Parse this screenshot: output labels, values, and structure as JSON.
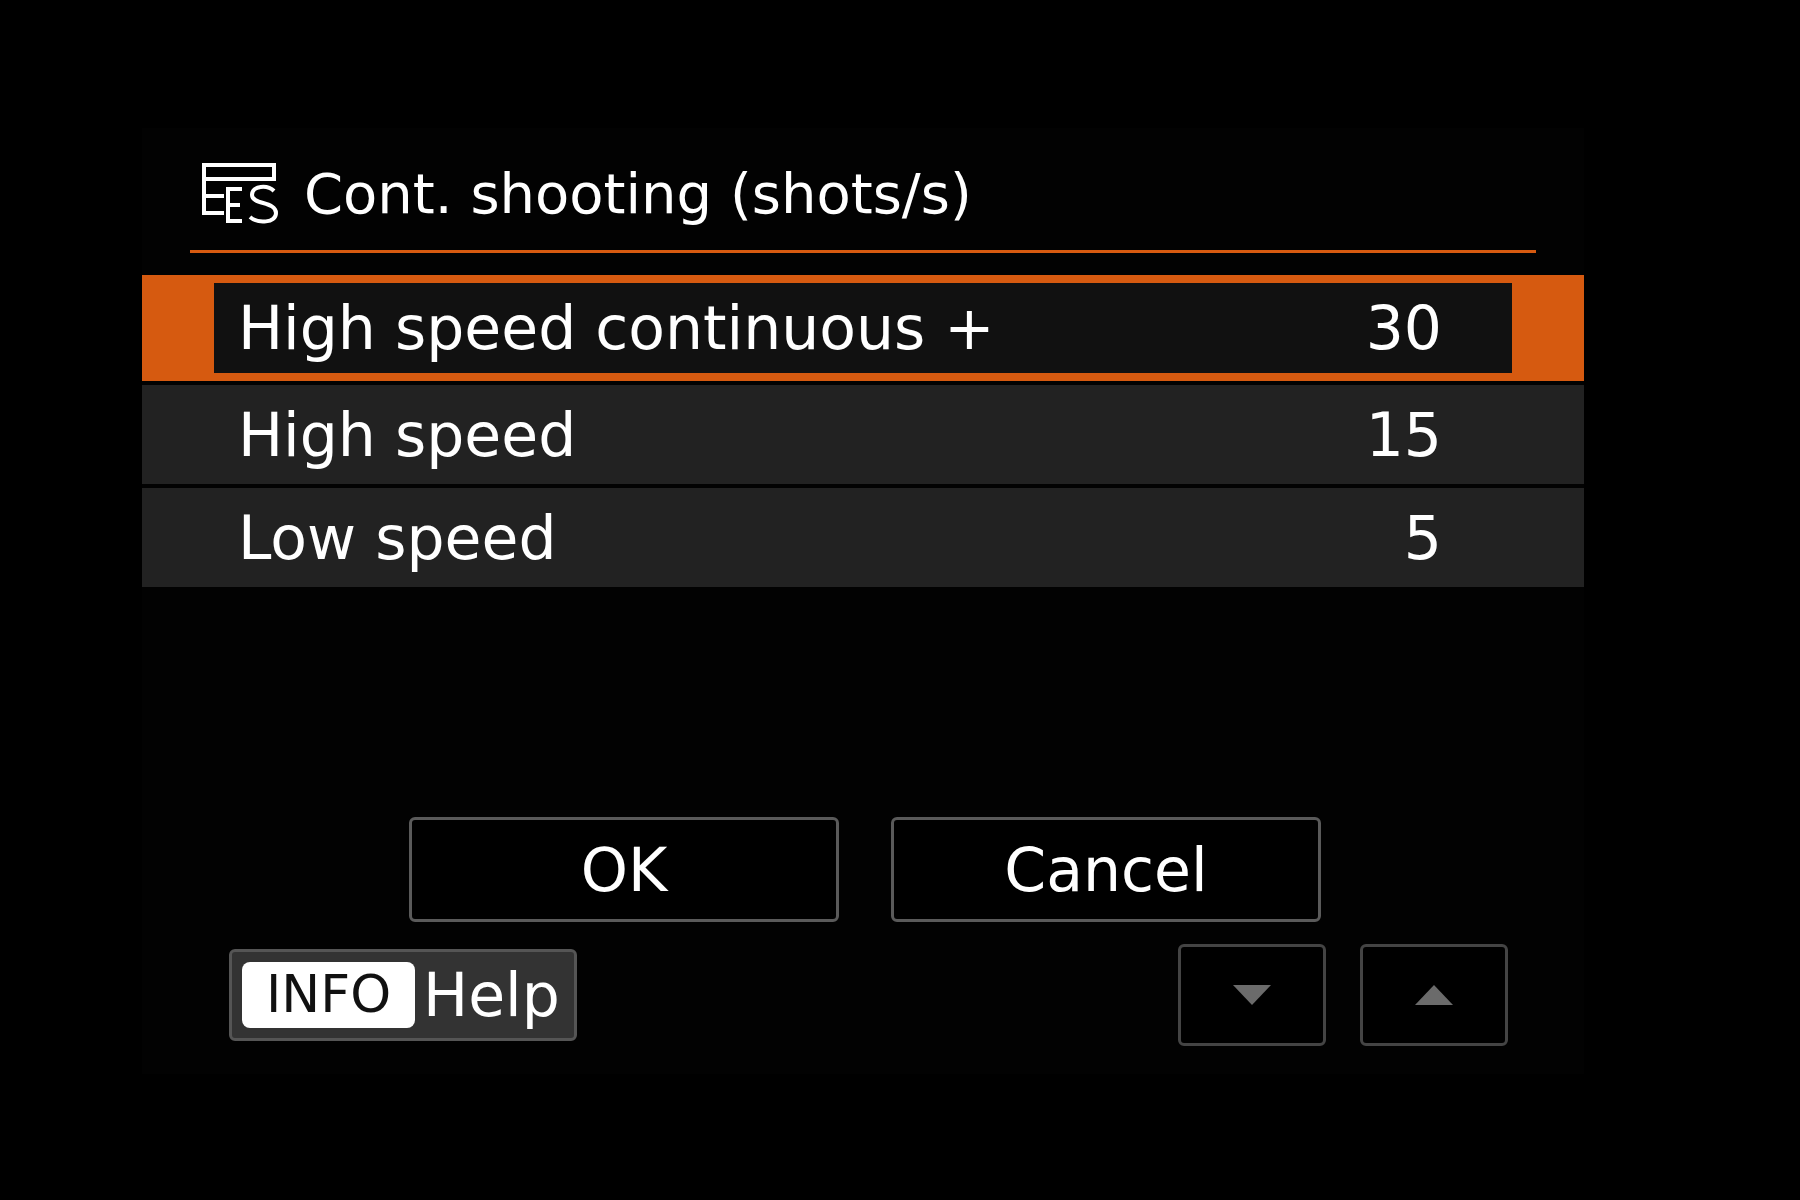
{
  "title": "Cont. shooting (shots/s)",
  "options": [
    {
      "label": "High speed continuous +",
      "value": "30",
      "selected": true
    },
    {
      "label": "High speed",
      "value": "15",
      "selected": false
    },
    {
      "label": "Low speed",
      "value": "5",
      "selected": false
    }
  ],
  "buttons": [
    {
      "label": "OK"
    },
    {
      "label": "Cancel"
    }
  ],
  "help": {
    "key": "INFO",
    "label": "Help"
  },
  "nav": [
    {
      "kind": "down"
    },
    {
      "kind": "up"
    }
  ]
}
